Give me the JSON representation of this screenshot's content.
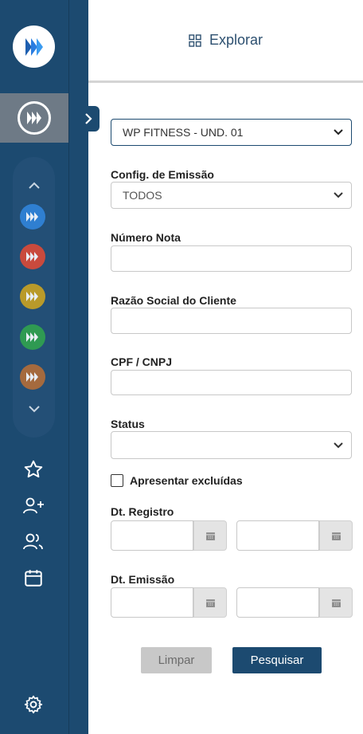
{
  "header": {
    "explore_label": "Explorar",
    "explore_icon": "grid-icon"
  },
  "sidebar": {
    "logo_icon": "brand-logo-icon",
    "apps": [
      {
        "name": "app-blue",
        "color": "#2f7fd1"
      },
      {
        "name": "app-red",
        "color": "#c94a3d"
      },
      {
        "name": "app-gold",
        "color": "#b99a2a"
      },
      {
        "name": "app-green",
        "color": "#2f9a52"
      },
      {
        "name": "app-brown",
        "color": "#a56a3e"
      }
    ],
    "nav": [
      "star-icon",
      "add-user-icon",
      "users-icon",
      "calendar-icon"
    ],
    "settings_icon": "gear-icon"
  },
  "form": {
    "unit": "WP FITNESS - UND. 01",
    "config_label": "Config. de Emissão",
    "config_value": "TODOS",
    "numero_label": "Número Nota",
    "numero_value": "",
    "razao_label": "Razão Social do Cliente",
    "razao_value": "",
    "cpf_label": "CPF / CNPJ",
    "cpf_value": "",
    "status_label": "Status",
    "status_value": "",
    "excluidas_label": "Apresentar excluídas",
    "excluidas_checked": false,
    "registro_label": "Dt. Registro",
    "emissao_label": "Dt. Emissão",
    "clear_label": "Limpar",
    "search_label": "Pesquisar"
  },
  "colors": {
    "primary": "#1c4a70",
    "active_app_bg": "#6e7a86",
    "clear_bg": "#c8c8c8"
  }
}
